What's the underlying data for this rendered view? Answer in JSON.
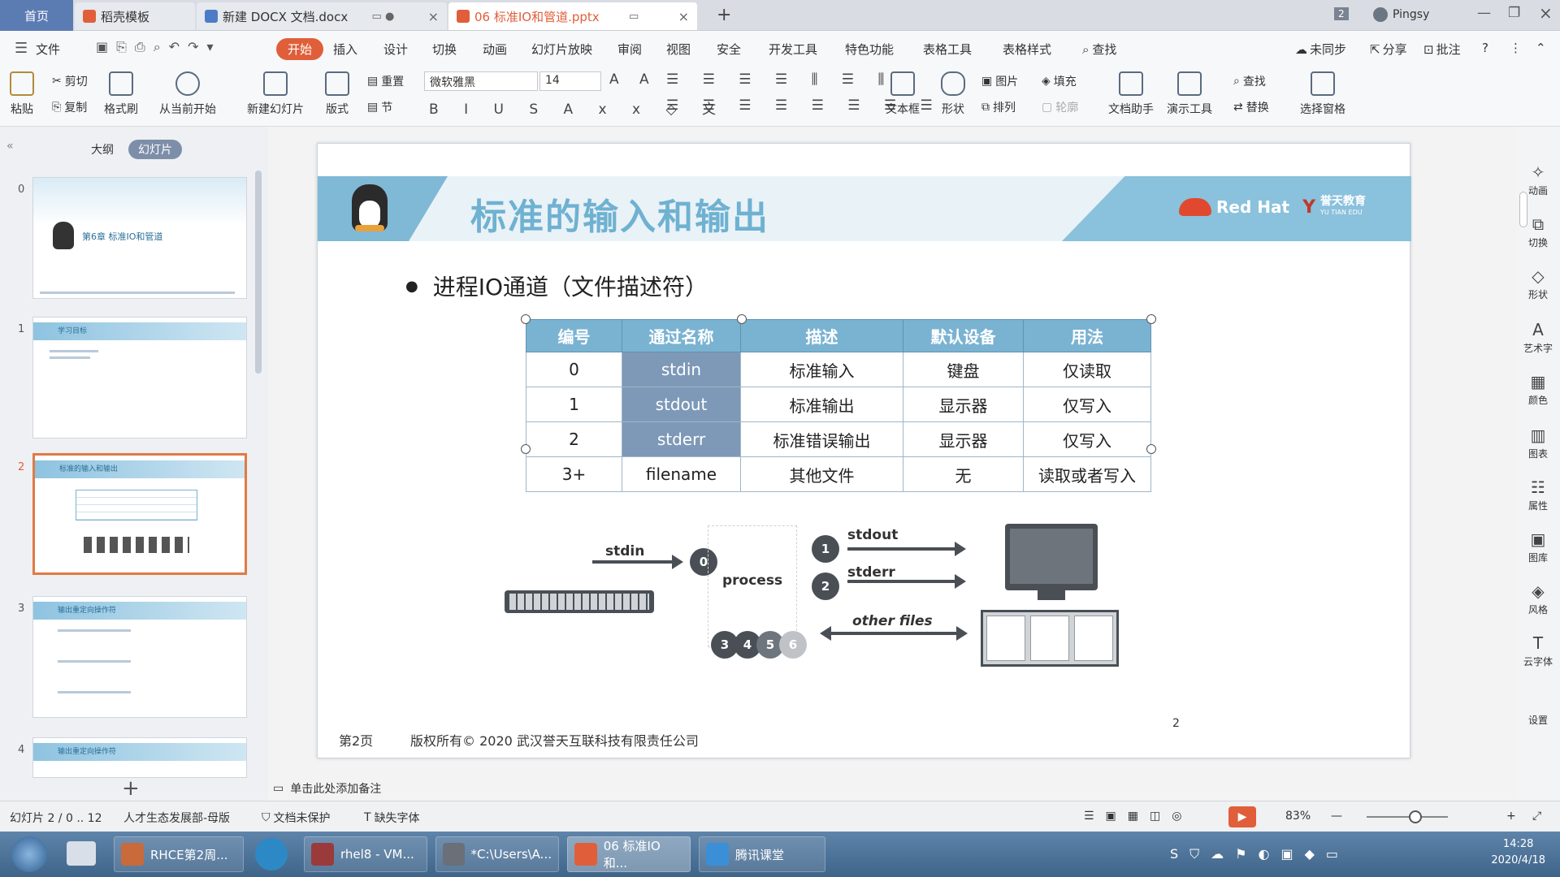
{
  "tabs": {
    "home": "首页",
    "t1": "稻壳模板",
    "t2": "新建 DOCX 文档.docx",
    "t3": "06 标准IO和管道.pptx",
    "new_tab": "+",
    "badge": "2",
    "user": "Pingsy"
  },
  "menu": {
    "file": "文件",
    "start": "开始",
    "insert": "插入",
    "design": "设计",
    "switch": "切换",
    "animation": "动画",
    "slideshow": "幻灯片放映",
    "review": "审阅",
    "view": "视图",
    "security": "安全",
    "devtools": "开发工具",
    "special": "特色功能",
    "tabletools": "表格工具",
    "tablestyle": "表格样式",
    "find": "查找",
    "sync": "未同步",
    "share": "分享",
    "annotate": "批注"
  },
  "ribbon": {
    "paste": "粘贴",
    "cut": "剪切",
    "copy": "复制",
    "format_painter": "格式刷",
    "from_current": "从当前开始",
    "new_slide": "新建幻灯片",
    "layout": "版式",
    "reset": "重置",
    "section": "节",
    "font_name": "微软雅黑",
    "font_size": "14",
    "textbox": "文本框",
    "shape": "形状",
    "picture": "图片",
    "fill": "填充",
    "arrange": "排列",
    "outline": "轮廓",
    "doc_helper": "文档助手",
    "present_tools": "演示工具",
    "find": "查找",
    "replace": "替换",
    "select_pane": "选择窗格"
  },
  "leftpane": {
    "outline_tab": "大纲",
    "slides_tab": "幻灯片",
    "thumbs": [
      {
        "num": "0",
        "title": "第6章  标准IO和管道"
      },
      {
        "num": "1",
        "title": "学习目标"
      },
      {
        "num": "2",
        "title": "标准的输入和输出"
      },
      {
        "num": "3",
        "title": "输出重定向操作符"
      },
      {
        "num": "4",
        "title": "输出重定向操作符"
      }
    ],
    "add": "+"
  },
  "slide": {
    "title": "标准的输入和输出",
    "brand": "Red Hat",
    "brand2": "誉天教育",
    "brand3": "YU TIAN EDU",
    "bullet": "进程IO通道（文件描述符）",
    "table": {
      "headers": [
        "编号",
        "通过名称",
        "描述",
        "默认设备",
        "用法"
      ],
      "rows": [
        [
          "0",
          "stdin",
          "标准输入",
          "键盘",
          "仅读取"
        ],
        [
          "1",
          "stdout",
          "标准输出",
          "显示器",
          "仅写入"
        ],
        [
          "2",
          "stderr",
          "标准错误输出",
          "显示器",
          "仅写入"
        ],
        [
          "3+",
          "filename",
          "其他文件",
          "无",
          "读取或者写入"
        ]
      ]
    },
    "diagram": {
      "stdin": "stdin",
      "process": "process",
      "stdout": "stdout",
      "stderr": "stderr",
      "other_files": "other files",
      "fd0": "0",
      "fd1": "1",
      "fd2": "2",
      "fd3": "3",
      "fd4": "4",
      "fd5": "5",
      "fd6": "6"
    },
    "footer_page": "第2页",
    "footer_copyright": "版权所有© 2020 武汉誉天互联科技有限责任公司",
    "page_number": "2"
  },
  "notes": "单击此处添加备注",
  "rightbar": [
    "动画",
    "切换",
    "形状",
    "艺术字",
    "颜色",
    "图表",
    "属性",
    "图库",
    "风格",
    "云字体",
    "设置"
  ],
  "status": {
    "slide": "幻灯片 2 / 0 .. 12",
    "template": "人才生态发展部-母版",
    "protect": "文档未保护",
    "missing_font": "缺失字体",
    "zoom": "83%"
  },
  "taskbar": {
    "items": [
      "RHCE第2周...",
      "rhel8 - VM...",
      "*C:\\Users\\A...",
      "06 标准IO和...",
      "腾讯课堂"
    ],
    "time": "14:28",
    "date": "2020/4/18"
  }
}
